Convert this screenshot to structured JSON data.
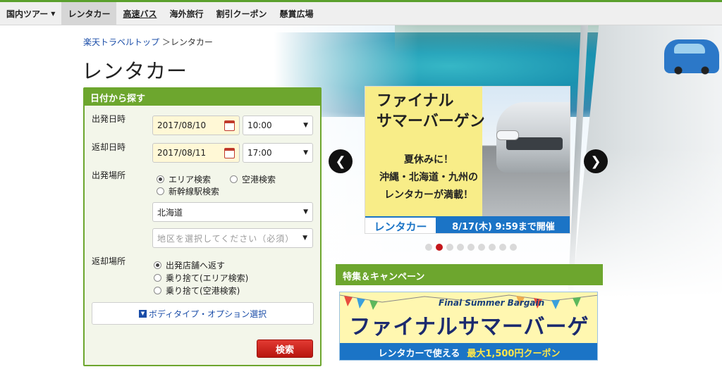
{
  "nav": {
    "items": [
      {
        "label": "国内ツアー",
        "caret": "▼"
      },
      {
        "label": "レンタカー"
      },
      {
        "label": "高速バス"
      },
      {
        "label": "海外旅行"
      },
      {
        "label": "割引クーポン"
      },
      {
        "label": "懸賞広場"
      }
    ]
  },
  "breadcrumb": {
    "home": "楽天トラベルトップ",
    "sep": "＞",
    "current": "レンタカー"
  },
  "page_title": "レンタカー",
  "search": {
    "heading": "日付から探す",
    "depart_label": "出発日時",
    "depart_date": "2017/08/10",
    "depart_time": "10:00",
    "return_label": "返却日時",
    "return_date": "2017/08/11",
    "return_time": "17:00",
    "depart_place_label": "出発場所",
    "place_options": [
      "エリア検索",
      "空港検索",
      "新幹線駅検索"
    ],
    "prefecture": "北海道",
    "region_placeholder": "地区を選択してください（必須）",
    "return_place_label": "返却場所",
    "return_options": [
      "出発店舗へ返す",
      "乗り捨て(エリア検索)",
      "乗り捨て(空港検索)"
    ],
    "options_link": "ボディタイプ・オプション選択",
    "submit": "検索"
  },
  "carousel": {
    "title": "ファイナル\nサマーバーゲン",
    "subtitle": "夏休みに！\n沖縄・北海道・九州の\nレンタカーが満載！",
    "label": "レンタカー",
    "period": "8/17(木) 9:59まで開催",
    "prev": "❮",
    "next": "❯",
    "slide_count": 9,
    "active_slide": 2
  },
  "campaign": {
    "heading": "特集＆キャンペーン",
    "banner_en": "Final Summer Bargain",
    "banner_title": "ファイナルサマーバーゲン",
    "banner_foot_left": "レンタカーで使える",
    "banner_foot_right": "最大1,500円クーポン"
  },
  "colors": {
    "brand_green": "#6da62e",
    "accent_red": "#c4171b",
    "accent_blue": "#1b74c6"
  }
}
